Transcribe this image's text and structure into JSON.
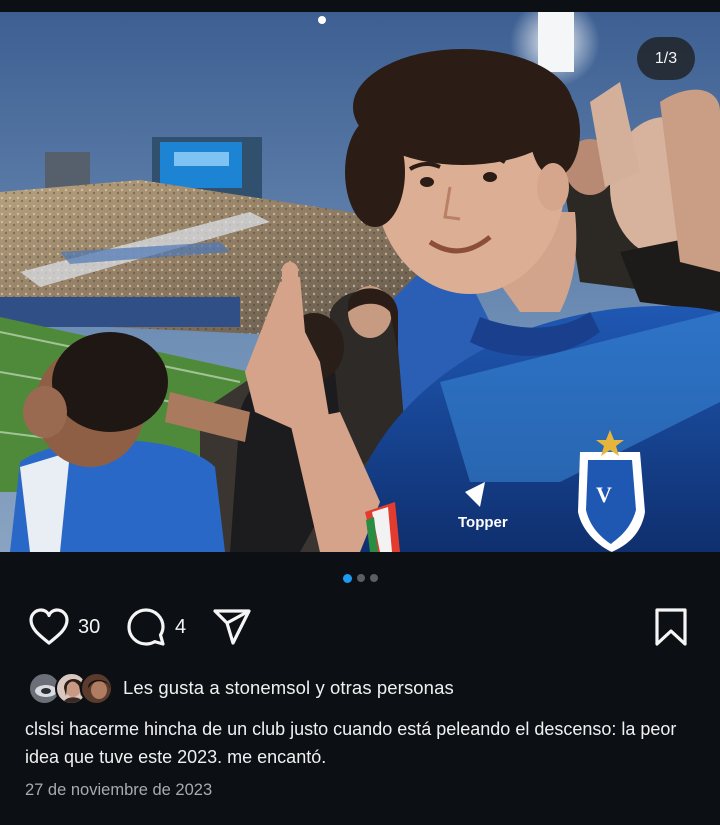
{
  "post": {
    "image_counter": "1/3",
    "image_alt": "Selfie at a football stadium with fans of Vélez Sarsfield",
    "carousel": {
      "total": 3,
      "active": 1
    },
    "actions": {
      "like_icon": "heart-icon",
      "like_count": "30",
      "comment_icon": "comment-icon",
      "comment_count": "4",
      "share_icon": "send-icon",
      "save_icon": "bookmark-icon"
    },
    "liked_by_text": "Les gusta a stonemsol y otras personas",
    "caption": "clslsi hacerme hincha de un club justo cuando está peleando el descenso: la peor idea que tuve este 2023. me encantó.",
    "date": "27 de noviembre de 2023"
  },
  "colors": {
    "background": "#0c1014",
    "accent_dot": "#1d9bf0",
    "muted_text": "#a6abb1"
  }
}
